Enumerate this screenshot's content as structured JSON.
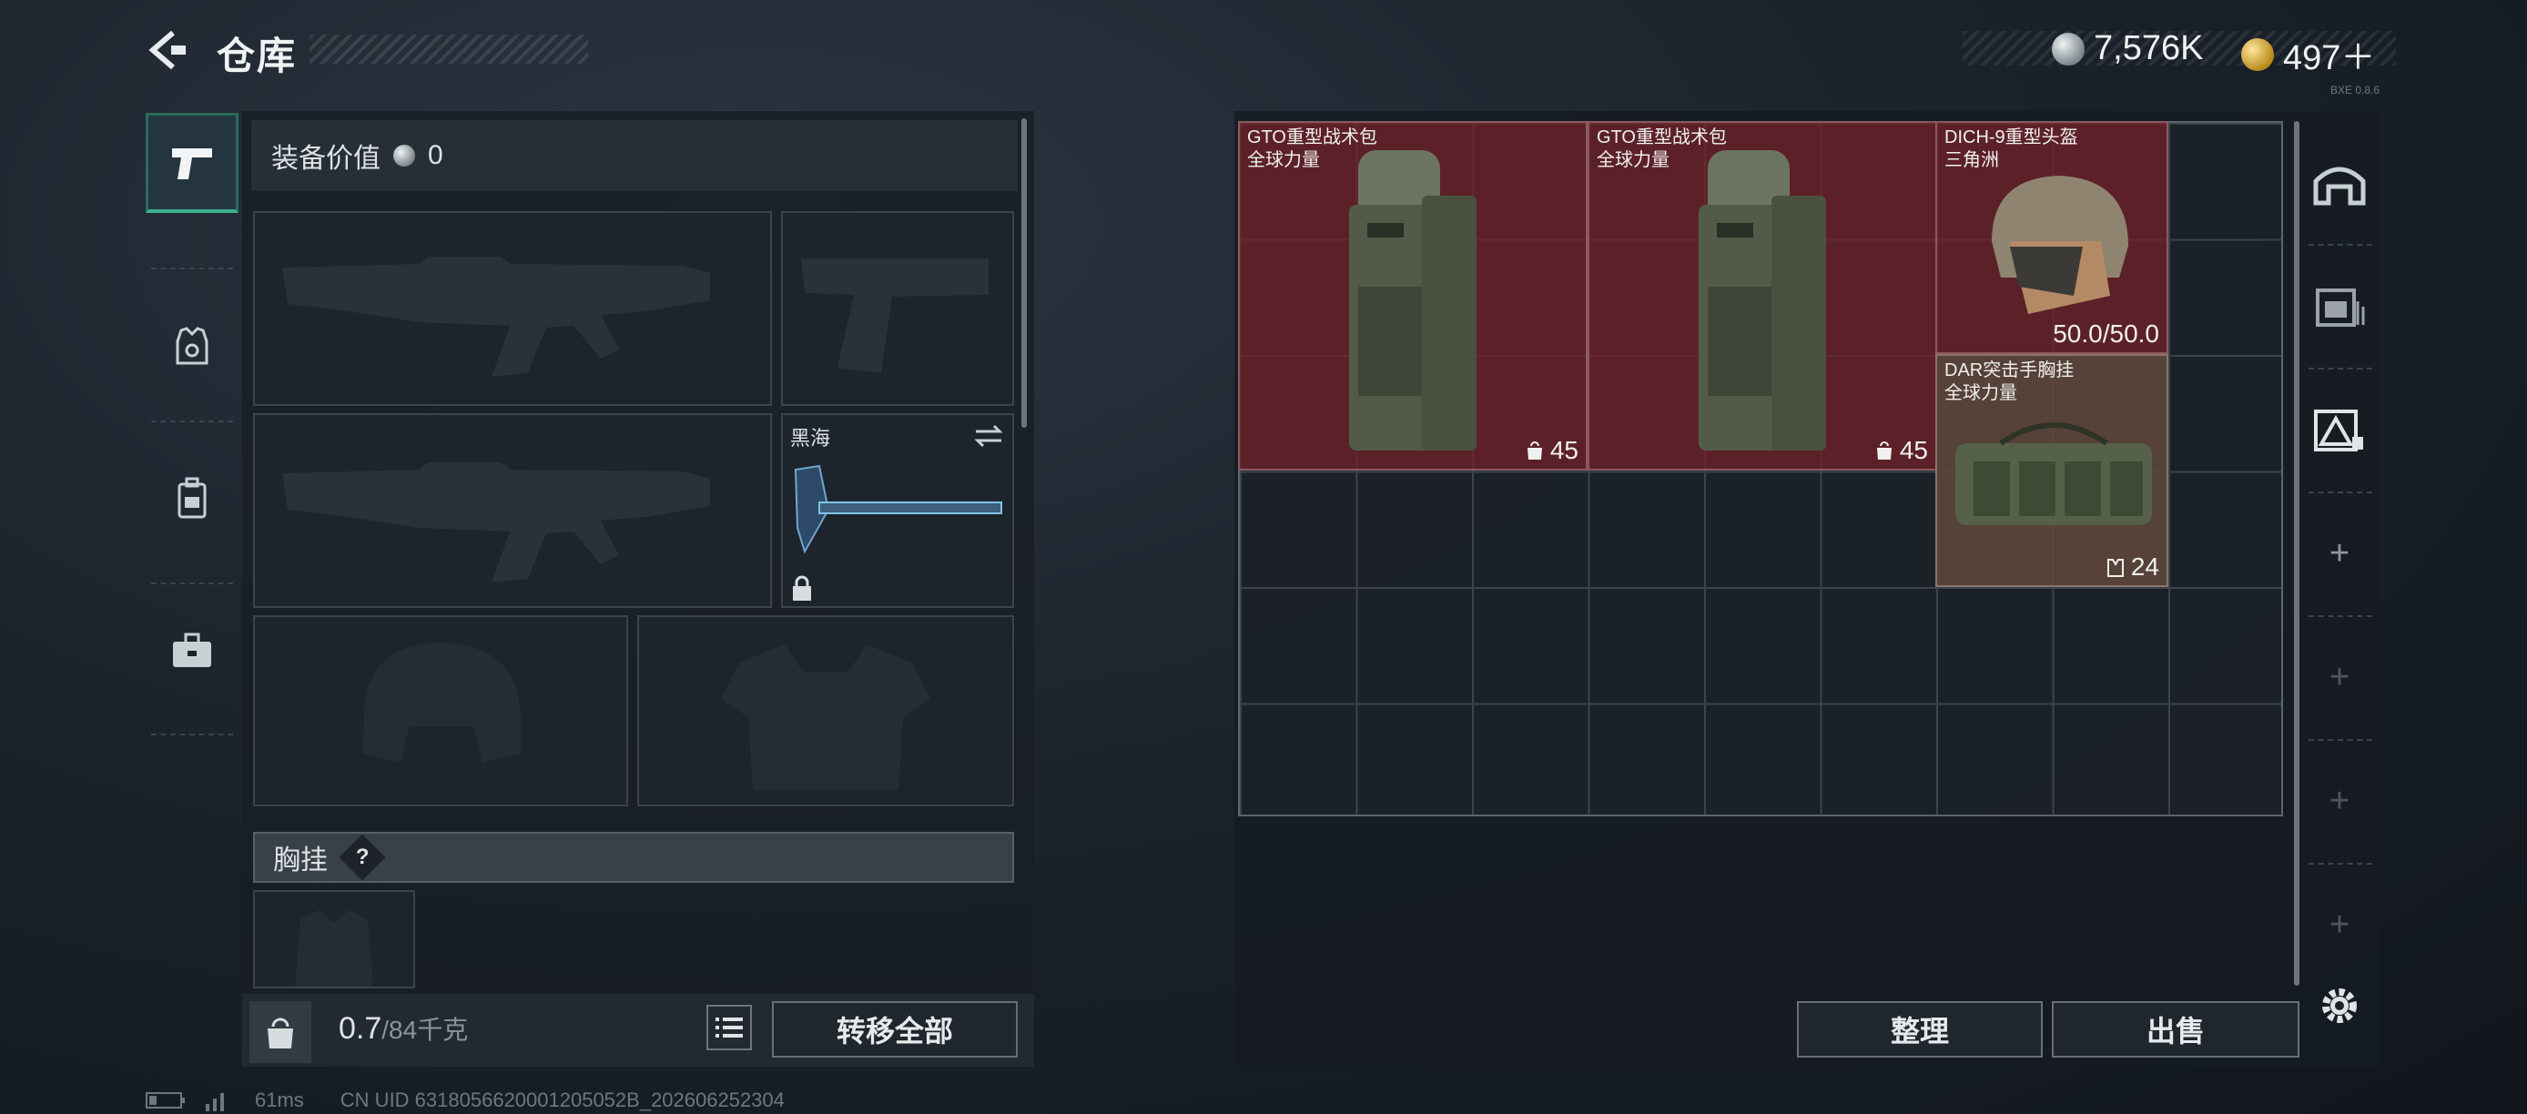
{
  "header": {
    "title": "仓库",
    "silver_amount": "7,576K",
    "gold_amount": "497＋",
    "version_tag": "BXE 0.8.6"
  },
  "sidebar": {
    "tabs": [
      {
        "name": "weapons-tab",
        "icon": "pistol-icon",
        "active": true
      },
      {
        "name": "armor-tab",
        "icon": "armor-vest-icon",
        "active": false
      },
      {
        "name": "backpack-tab",
        "icon": "backpack-icon",
        "active": false
      },
      {
        "name": "case-tab",
        "icon": "briefcase-icon",
        "active": false
      }
    ]
  },
  "equipment": {
    "value_label": "装备价值",
    "value_amount": "0",
    "melee": {
      "label": "黑海",
      "icon": "axe-icon",
      "locked": true
    },
    "chest_rig_label": "胸挂",
    "chest_rig_help": "?"
  },
  "footer": {
    "weight_icon_label": "KG",
    "weight_current": "0.7",
    "weight_max": "/84千克",
    "transfer_all_label": "转移全部",
    "sort_label": "整理",
    "sell_label": "出售"
  },
  "stash": {
    "items": [
      {
        "name_line1": "GTO重型战术包",
        "name_line2": "全球力量",
        "count": "45",
        "count_icon": "weight-bag-icon",
        "color": "red"
      },
      {
        "name_line1": "GTO重型战术包",
        "name_line2": "全球力量",
        "count": "45",
        "count_icon": "weight-bag-icon",
        "color": "red"
      },
      {
        "name_line1": "DICH-9重型头盔",
        "name_line2": "三角洲",
        "count": "50.0/50.0",
        "color": "red"
      },
      {
        "name_line1": "DAR突击手胸挂",
        "name_line2": "全球力量",
        "count": "24",
        "count_icon": "vest-slots-icon",
        "color": "brown"
      }
    ]
  },
  "right_column": {
    "icons": [
      "home-base-icon",
      "stash-crate-icon",
      "warning-stash-icon",
      "add-icon",
      "add-icon",
      "add-icon",
      "add-icon"
    ]
  },
  "status_bar": {
    "ping": "61ms",
    "uid": "CN UID 6318056620001205052B_202606252304"
  },
  "colors": {
    "item_red": "#73222a",
    "item_brown": "#62483c",
    "active_tab": "#3fb08c"
  }
}
